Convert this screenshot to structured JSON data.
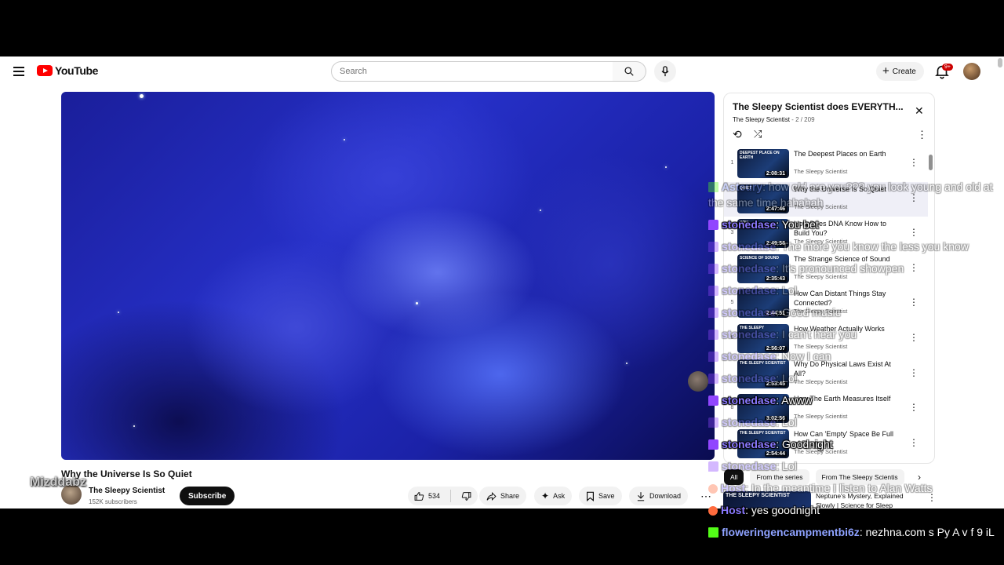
{
  "header": {
    "logo_text": "YouTube",
    "search_placeholder": "Search",
    "create_label": "Create",
    "notification_badge": "9+"
  },
  "video": {
    "title": "Why the Universe Is So Quiet",
    "channel_name": "The Sleepy Scientist",
    "subscribers": "152K subscribers",
    "subscribe_label": "Subscribe",
    "likes": "534",
    "share_label": "Share",
    "ask_label": "Ask",
    "save_label": "Save",
    "download_label": "Download"
  },
  "playlist": {
    "title": "The Sleepy Scientist does EVERYTH...",
    "owner": "The Sleepy Scientist",
    "position": "2 / 209",
    "items": [
      {
        "index": "1",
        "title": "The Deepest Places on Earth",
        "channel": "The Sleepy Scientist",
        "duration": "2:08:31",
        "thumb_caption": "DEEPEST PLACE ON EARTH"
      },
      {
        "index": "",
        "title": "Why the Universe Is So Quiet",
        "channel": "The Sleepy Scientist",
        "duration": "2:47:46",
        "thumb_caption": "QUIET"
      },
      {
        "index": "3",
        "title": "How Does DNA Know How to Build You?",
        "channel": "The Sleepy Scientist",
        "duration": "2:49:58",
        "thumb_caption": "YOU"
      },
      {
        "index": "",
        "title": "The Strange Science of Sound",
        "channel": "The Sleepy Scientist",
        "duration": "2:35:43",
        "thumb_caption": "SCIENCE OF SOUND"
      },
      {
        "index": "5",
        "title": "How Can Distant Things Stay Connected?",
        "channel": "The Sleepy Scientist",
        "duration": "2:44:51",
        "thumb_caption": ""
      },
      {
        "index": "6",
        "title": "How Weather Actually Works",
        "channel": "The Sleepy Scientist",
        "duration": "2:56:07",
        "thumb_caption": "THE SLEEPY"
      },
      {
        "index": "",
        "title": "Why Do Physical Laws Exist At All?",
        "channel": "The Sleepy Scientist",
        "duration": "2:53:45",
        "thumb_caption": "THE SLEEPY SCIENTIST"
      },
      {
        "index": "8",
        "title": "How The Earth Measures Itself",
        "channel": "The Sleepy Scientist",
        "duration": "3:02:56",
        "thumb_caption": ""
      },
      {
        "index": "",
        "title": "How Can 'Empty' Space Be Full of Energy?",
        "channel": "The Sleepy Scientist",
        "duration": "2:54:44",
        "thumb_caption": "THE SLEEPY SCIENTIST"
      }
    ]
  },
  "chips": [
    "All",
    "From the series",
    "From The Sleepy Scientis"
  ],
  "recommended": {
    "title": "Neptune's Mystery, Explained Slowly | Science for Sleep",
    "thumb_caption": "THE SLEEPY SCIENTIST"
  },
  "overlay": {
    "watermark": "Mizddabz",
    "chat": [
      {
        "platform": "kick",
        "user": "Asteury",
        "message": "how old are you??? you look young and old at the same time hahahah",
        "color": "#8ea2ff",
        "ghost": true
      },
      {
        "platform": "twitch",
        "user": "stonedase",
        "message": "You bet",
        "color": "#8a79ff",
        "ghost": false
      },
      {
        "platform": "twitch",
        "user": "stonedase",
        "message": "The more you know the less you know",
        "color": "#8a79ff",
        "ghost": true
      },
      {
        "platform": "twitch",
        "user": "stonedase",
        "message": "It's pronounced showpen",
        "color": "#8a79ff",
        "ghost": true
      },
      {
        "platform": "twitch",
        "user": "stonedase",
        "message": "Lol",
        "color": "#8a79ff",
        "ghost": true
      },
      {
        "platform": "twitch",
        "user": "stonedase",
        "message": "Good music",
        "color": "#8a79ff",
        "ghost": true
      },
      {
        "platform": "twitch",
        "user": "stonedase",
        "message": "I can't hear you",
        "color": "#8a79ff",
        "ghost": true
      },
      {
        "platform": "twitch",
        "user": "stonedase",
        "message": "Now I can",
        "color": "#8a79ff",
        "ghost": true
      },
      {
        "platform": "twitch",
        "user": "stonedase",
        "message": "Lol",
        "color": "#8a79ff",
        "ghost": true
      },
      {
        "platform": "twitch",
        "user": "stonedase",
        "message": "Awww",
        "color": "#8a79ff",
        "ghost": false
      },
      {
        "platform": "twitch",
        "user": "stonedase",
        "message": "Lol",
        "color": "#8a79ff",
        "ghost": true
      },
      {
        "platform": "twitch",
        "user": "stonedase",
        "message": "Goodnight",
        "color": "#8a79ff",
        "ghost": false
      },
      {
        "platform": "twitch",
        "user": "stonedase",
        "message": "Lol",
        "color": "#8a79ff",
        "ghost": true
      },
      {
        "platform": "host",
        "user": "Host",
        "message": "In the meantime I listen to Alan Watts",
        "color": "#8a79ff",
        "ghost": true
      },
      {
        "platform": "host",
        "user": "Host",
        "message": "yes goodnight",
        "color": "#8a79ff",
        "ghost": false
      },
      {
        "platform": "kick",
        "user": "floweringencampmentbi6z",
        "message": "nezhna.com s Py A v f 9 iL",
        "color": "#8ea2ff",
        "ghost": false
      }
    ]
  }
}
